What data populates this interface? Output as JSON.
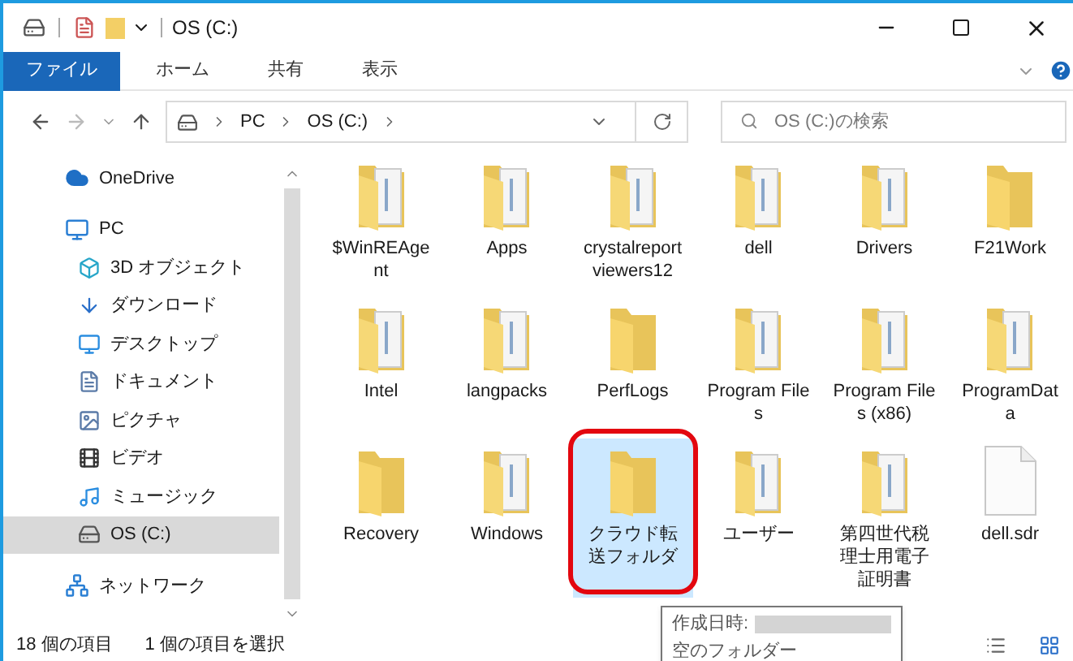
{
  "window": {
    "title": "OS (C:)"
  },
  "ribbon_tabs": [
    {
      "label": "ファイル",
      "selected": true
    },
    {
      "label": "ホーム",
      "selected": false
    },
    {
      "label": "共有",
      "selected": false
    },
    {
      "label": "表示",
      "selected": false
    }
  ],
  "address": {
    "path": [
      "PC",
      "OS (C:)"
    ]
  },
  "search": {
    "placeholder": "OS (C:)の検索"
  },
  "sidebar": {
    "items": [
      {
        "label": "OneDrive",
        "selected": false
      },
      {
        "label": "PC",
        "selected": false,
        "children": [
          {
            "label": "3D オブジェクト",
            "selected": false
          },
          {
            "label": "ダウンロード",
            "selected": false
          },
          {
            "label": "デスクトップ",
            "selected": false
          },
          {
            "label": "ドキュメント",
            "selected": false
          },
          {
            "label": "ピクチャ",
            "selected": false
          },
          {
            "label": "ビデオ",
            "selected": false
          },
          {
            "label": "ミュージック",
            "selected": false
          },
          {
            "label": "OS (C:)",
            "selected": true
          }
        ]
      },
      {
        "label": "ネットワーク",
        "selected": false
      }
    ]
  },
  "files": [
    {
      "name": "$WinREAgent",
      "kind": "folder",
      "selected": false,
      "annotated": false
    },
    {
      "name": "Apps",
      "kind": "folder",
      "selected": false,
      "annotated": false
    },
    {
      "name": "crystalreportviewers12",
      "kind": "folder",
      "selected": false,
      "annotated": false
    },
    {
      "name": "dell",
      "kind": "folder",
      "selected": false,
      "annotated": false
    },
    {
      "name": "Drivers",
      "kind": "folder",
      "selected": false,
      "annotated": false
    },
    {
      "name": "F21Work",
      "kind": "empty-folder",
      "selected": false,
      "annotated": false
    },
    {
      "name": "Intel",
      "kind": "folder",
      "selected": false,
      "annotated": false
    },
    {
      "name": "langpacks",
      "kind": "folder",
      "selected": false,
      "annotated": false
    },
    {
      "name": "PerfLogs",
      "kind": "empty-folder",
      "selected": false,
      "annotated": false
    },
    {
      "name": "Program Files",
      "kind": "folder",
      "selected": false,
      "annotated": false
    },
    {
      "name": "Program Files (x86)",
      "kind": "folder",
      "selected": false,
      "annotated": false
    },
    {
      "name": "ProgramData",
      "kind": "folder",
      "selected": false,
      "annotated": false
    },
    {
      "name": "Recovery",
      "kind": "empty-folder",
      "selected": false,
      "annotated": false
    },
    {
      "name": "Windows",
      "kind": "folder",
      "selected": false,
      "annotated": false
    },
    {
      "name": "クラウド転送フォルダ",
      "kind": "empty-folder",
      "selected": true,
      "annotated": true
    },
    {
      "name": "ユーザー",
      "kind": "folder",
      "selected": false,
      "annotated": false
    },
    {
      "name": "第四世代税理士用電子証明書",
      "kind": "folder",
      "selected": false,
      "annotated": false
    },
    {
      "name": "dell.sdr",
      "kind": "file",
      "selected": false,
      "annotated": false
    }
  ],
  "tooltip": {
    "line_1": "作成日時:",
    "line_2": "空のフォルダー"
  },
  "status_bar": {
    "count": "18 個の項目",
    "selection": "1 個の項目を選択"
  }
}
